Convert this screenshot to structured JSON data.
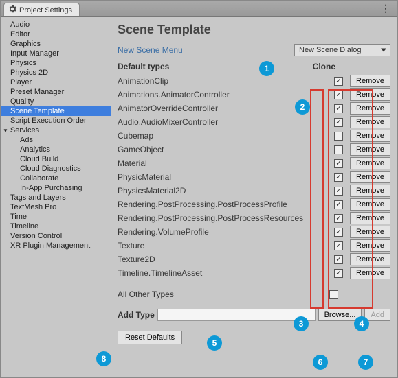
{
  "window_title": "Project Settings",
  "sidebar": [
    {
      "label": "Audio"
    },
    {
      "label": "Editor"
    },
    {
      "label": "Graphics"
    },
    {
      "label": "Input Manager"
    },
    {
      "label": "Physics"
    },
    {
      "label": "Physics 2D"
    },
    {
      "label": "Player"
    },
    {
      "label": "Preset Manager"
    },
    {
      "label": "Quality"
    },
    {
      "label": "Scene Template",
      "selected": true
    },
    {
      "label": "Script Execution Order"
    },
    {
      "label": "Services",
      "expanded": true,
      "children": [
        {
          "label": "Ads"
        },
        {
          "label": "Analytics"
        },
        {
          "label": "Cloud Build"
        },
        {
          "label": "Cloud Diagnostics"
        },
        {
          "label": "Collaborate"
        },
        {
          "label": "In-App Purchasing"
        }
      ]
    },
    {
      "label": "Tags and Layers"
    },
    {
      "label": "TextMesh Pro"
    },
    {
      "label": "Time"
    },
    {
      "label": "Timeline"
    },
    {
      "label": "Version Control"
    },
    {
      "label": "XR Plugin Management"
    }
  ],
  "page": {
    "title": "Scene Template",
    "link": "New Scene Menu",
    "dropdown": "New Scene Dialog",
    "default_types_label": "Default types",
    "clone_label": "Clone",
    "types": [
      {
        "name": "AnimationClip",
        "clone": true
      },
      {
        "name": "Animations.AnimatorController",
        "clone": true
      },
      {
        "name": "AnimatorOverrideController",
        "clone": true
      },
      {
        "name": "Audio.AudioMixerController",
        "clone": true
      },
      {
        "name": "Cubemap",
        "clone": false
      },
      {
        "name": "GameObject",
        "clone": false
      },
      {
        "name": "Material",
        "clone": true
      },
      {
        "name": "PhysicMaterial",
        "clone": true
      },
      {
        "name": "PhysicsMaterial2D",
        "clone": true
      },
      {
        "name": "Rendering.PostProcessing.PostProcessProfile",
        "clone": true
      },
      {
        "name": "Rendering.PostProcessing.PostProcessResources",
        "clone": true
      },
      {
        "name": "Rendering.VolumeProfile",
        "clone": true
      },
      {
        "name": "Texture",
        "clone": true
      },
      {
        "name": "Texture2D",
        "clone": true
      },
      {
        "name": "Timeline.TimelineAsset",
        "clone": true
      }
    ],
    "remove_label": "Remove",
    "all_other_label": "All Other Types",
    "all_other_clone": false,
    "add_type_label": "Add Type",
    "browse_label": "Browse...",
    "add_label": "Add",
    "reset_label": "Reset Defaults"
  },
  "callouts": [
    "1",
    "2",
    "3",
    "4",
    "5",
    "6",
    "7",
    "8"
  ]
}
